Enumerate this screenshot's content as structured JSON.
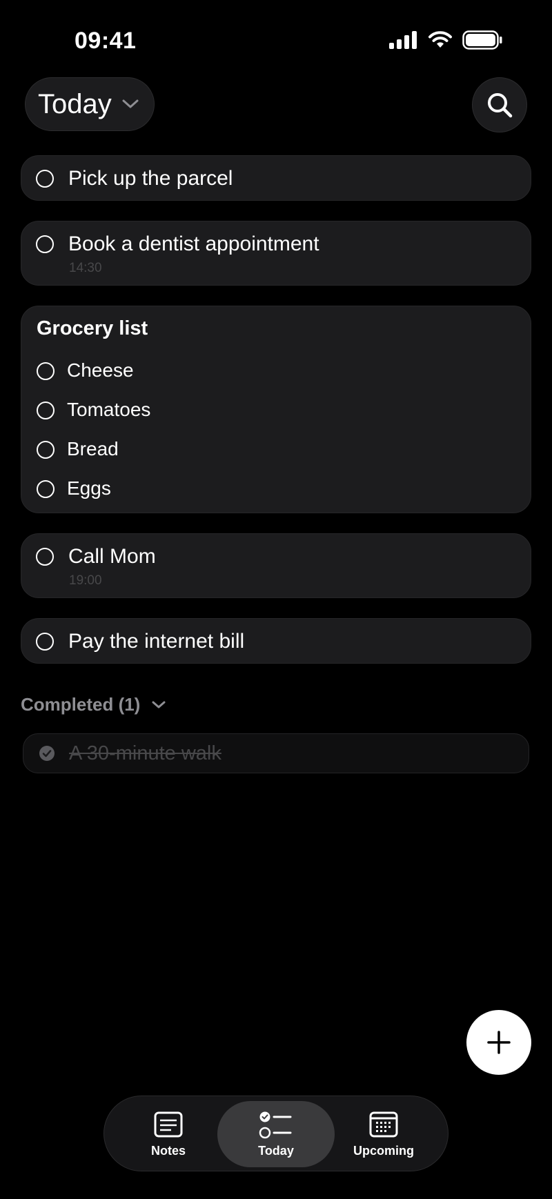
{
  "status_bar": {
    "time": "09:41",
    "icons": [
      "cellular-signal-icon",
      "wifi-icon",
      "battery-icon"
    ]
  },
  "header": {
    "title": "Today",
    "dropdown_icon": "chevron-down-icon",
    "search_icon": "search-icon"
  },
  "tasks": [
    {
      "label": "Pick up the parcel",
      "time": ""
    },
    {
      "label": "Book a dentist appointment",
      "time": "14:30"
    }
  ],
  "grocery": {
    "title": "Grocery list",
    "items": [
      "Cheese",
      "Tomatoes",
      "Bread",
      "Eggs"
    ]
  },
  "tasks_after": [
    {
      "label": "Call Mom",
      "time": "19:00"
    },
    {
      "label": "Pay the internet bill",
      "time": ""
    }
  ],
  "completed": {
    "label": "Completed (1)",
    "items": [
      {
        "label": "A 30-minute walk"
      }
    ]
  },
  "fab": {
    "icon": "plus-icon"
  },
  "tabbar": {
    "tabs": [
      {
        "label": "Notes",
        "icon": "notes-icon",
        "active": false
      },
      {
        "label": "Today",
        "icon": "checklist-icon",
        "active": true
      },
      {
        "label": "Upcoming",
        "icon": "calendar-icon",
        "active": false
      }
    ]
  },
  "colors": {
    "background": "#000000",
    "card": "#1c1c1e",
    "muted_text": "#8e8e93",
    "time_text": "#48484a",
    "active_tab": "#3a3a3c"
  }
}
